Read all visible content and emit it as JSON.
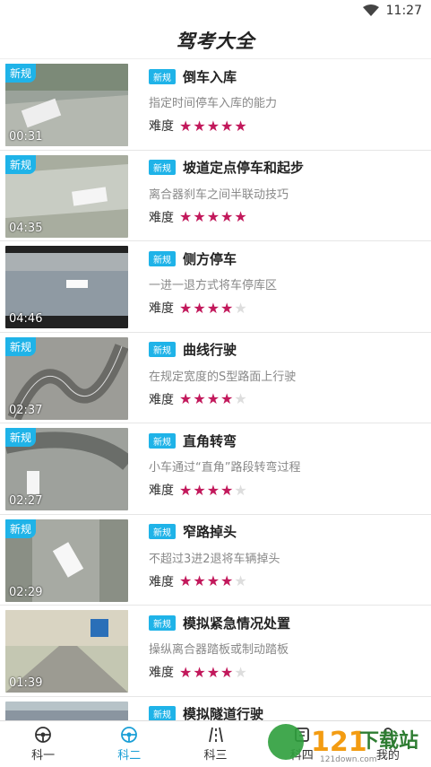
{
  "status": {
    "time": "11:27",
    "wifi_icon": "wifi-icon"
  },
  "header": {
    "title": "驾考大全"
  },
  "items": [
    {
      "badge": "新规",
      "duration": "00:31",
      "tag": "新规",
      "name": "倒车入库",
      "desc": "指定时间停车入库的能力",
      "difficulty_label": "难度",
      "stars": 5
    },
    {
      "badge": "新规",
      "duration": "04:35",
      "tag": "新规",
      "name": "坡道定点停车和起步",
      "desc": "离合器刹车之间半联动技巧",
      "difficulty_label": "难度",
      "stars": 5
    },
    {
      "badge": "",
      "duration": "04:46",
      "tag": "新规",
      "name": "侧方停车",
      "desc": "一进一退方式将车停库区",
      "difficulty_label": "难度",
      "stars": 4
    },
    {
      "badge": "新规",
      "duration": "02:37",
      "tag": "新规",
      "name": "曲线行驶",
      "desc": "在规定宽度的S型路面上行驶",
      "difficulty_label": "难度",
      "stars": 4
    },
    {
      "badge": "新规",
      "duration": "02:27",
      "tag": "新规",
      "name": "直角转弯",
      "desc": "小车通过“直角”路段转弯过程",
      "difficulty_label": "难度",
      "stars": 4
    },
    {
      "badge": "新规",
      "duration": "02:29",
      "tag": "新规",
      "name": "窄路掉头",
      "desc": "不超过3进2退将车辆掉头",
      "difficulty_label": "难度",
      "stars": 4
    },
    {
      "badge": "",
      "duration": "01:39",
      "tag": "新规",
      "name": "模拟紧急情况处置",
      "desc": "操纵离合器踏板或制动踏板",
      "difficulty_label": "难度",
      "stars": 4
    },
    {
      "badge": "",
      "duration": "",
      "tag": "新规",
      "name": "模拟隧道行驶",
      "desc": "",
      "difficulty_label": "",
      "stars": 0
    }
  ],
  "tabs": [
    {
      "label": "科一",
      "icon": "steering-wheel-icon",
      "active": false
    },
    {
      "label": "科二",
      "icon": "steering-wheel-icon",
      "active": true
    },
    {
      "label": "科三",
      "icon": "road-icon",
      "active": false
    },
    {
      "label": "科四",
      "icon": "book-icon",
      "active": false
    },
    {
      "label": "我的",
      "icon": "user-icon",
      "active": false
    }
  ],
  "watermark": {
    "text": "下载站",
    "number": "121",
    "domain": "121down.com"
  },
  "colors": {
    "accent": "#1fb3e8",
    "star": "#c2185b",
    "active_tab": "#1a9fd6"
  }
}
